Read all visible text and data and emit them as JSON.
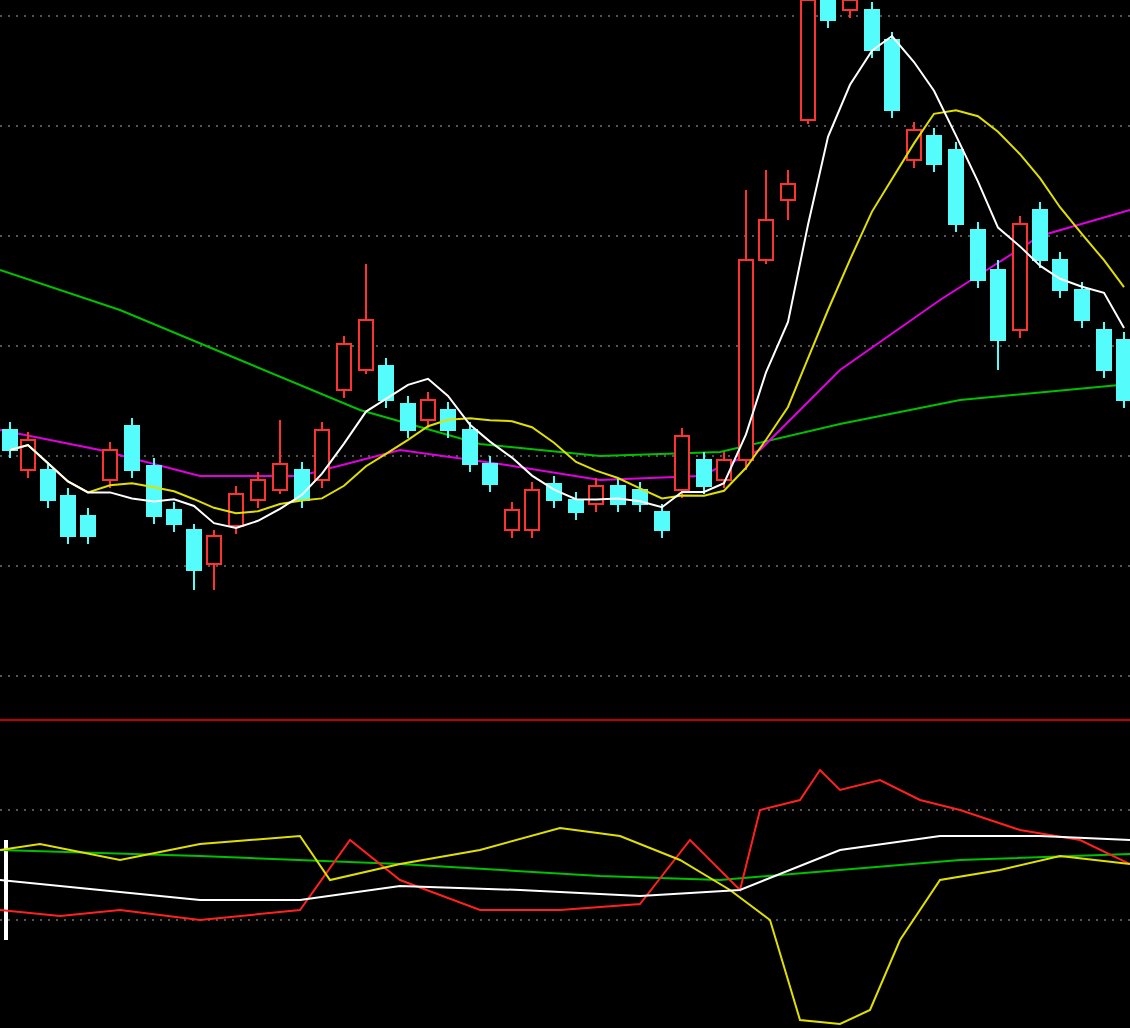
{
  "panels": [
    {
      "kind": "candlestick"
    },
    {
      "kind": "oscillator"
    }
  ]
}
